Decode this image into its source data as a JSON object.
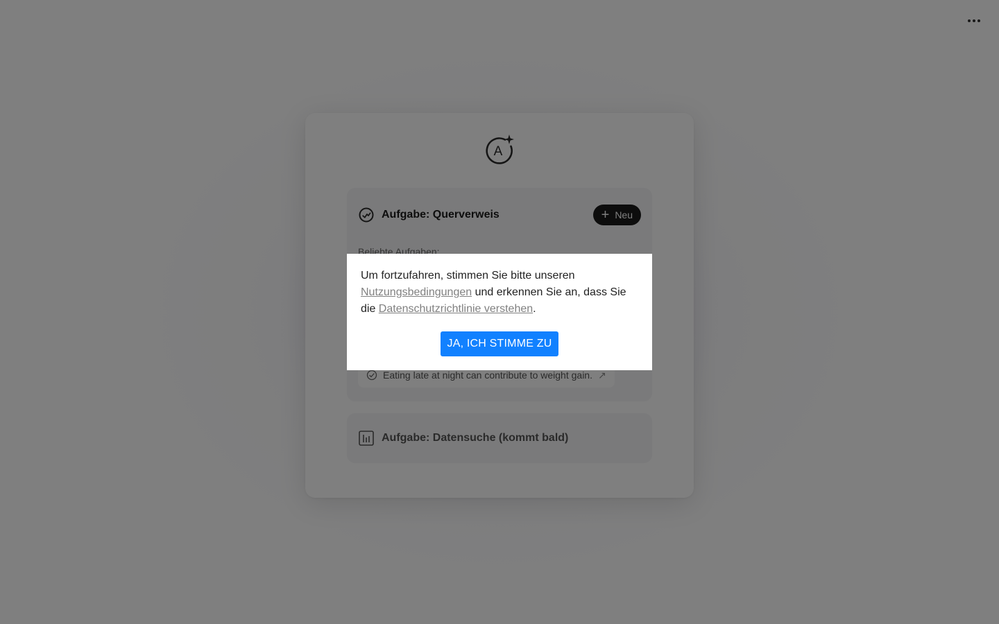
{
  "page": {
    "more_icon": "more-horizontal-icon"
  },
  "logo": {
    "icon": "ai-sparkle-logo-icon"
  },
  "task_crossref": {
    "icon": "check-circle-icon",
    "title": "Aufgabe: Querverweis",
    "new_button_label": "Neu",
    "popular_label": "Beliebte Aufgaben:",
    "suggestions": [
      {
        "text": "Eating late at night can contribute to weight gain.",
        "icon": "check-circle-icon",
        "arrow_icon": "arrow-icon"
      }
    ]
  },
  "task_datasearch": {
    "icon": "bar-chart-icon",
    "title": "Aufgabe: Datensuche (kommt bald)"
  },
  "consent_modal": {
    "text_part1": "Um fortzufahren, stimmen Sie bitte unseren ",
    "terms_link": "Nutzungsbedingungen",
    "text_part2": " und erkennen Sie an, dass Sie die ",
    "privacy_link": "Datenschutzrichtlinie verstehen",
    "text_part3": ".",
    "agree_button": "JA, ICH STIMME ZU"
  },
  "colors": {
    "primary_button": "#1181ff",
    "dark_button": "#1a1a1a",
    "overlay": "rgba(0,0,0,0.5)"
  }
}
